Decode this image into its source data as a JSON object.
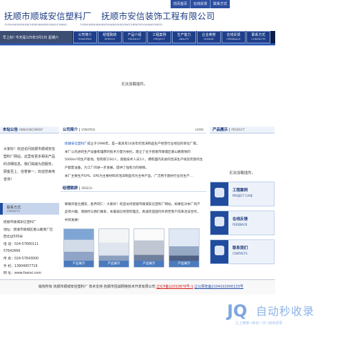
{
  "header": {
    "company_cn_1": "抚顺市顺城安信塑料厂",
    "company_cn_2": "抚顺市安信装饰工程有限公司",
    "pinyin_1": "FUSHUNSHISHUNCHENGANXINSUIJIAOCHANG",
    "pinyin_2": "FUSHUNSHIANXINZHUANGSHIGONGCHENGYOUXIANGONGSI",
    "top_links": [
      "前页首页",
      "在线反馈",
      "联系方式"
    ]
  },
  "nav": {
    "date": "早上好! 今天是125年3月1日 星期六",
    "items": [
      {
        "cn": "公司简介",
        "en": "SYNOPSIS"
      },
      {
        "cn": "经理致辞",
        "en": "SPEECH"
      },
      {
        "cn": "产品介绍",
        "en": "PRODUCT"
      },
      {
        "cn": "工程案例",
        "en": "PROJECT"
      },
      {
        "cn": "生产能力",
        "en": "ABILITY"
      },
      {
        "cn": "企业荣誉",
        "en": "HONOR"
      },
      {
        "cn": "在线反馈",
        "en": "FEEDBACK"
      },
      {
        "cn": "联系方式",
        "en": "CONTACTS"
      }
    ]
  },
  "banner": {
    "text": "无法加载插件。"
  },
  "left": {
    "announcement_title": "本站公告",
    "announcement_en": "ANNOUNCEMENT",
    "announcement_text": "大家好！欢迎访问抚顺市顺城安信塑料厂网站，这里有更多相关产品的详细信息。我们竭诚为您服务，顾客至上、信誉第一，欢迎您来电咨询！",
    "contact_title": "联系方式",
    "contact_en": "CONTACTS",
    "contact_lines": [
      "抚顺市顺城安信塑料厂",
      "地址：抚顺市顺城区葛山路南厂区",
      "西北边500米",
      "电 话：024-57660111 57642666",
      "传 真：024-57643000",
      "手 机：13904957719",
      "网 址：www.fsanxi.com"
    ]
  },
  "center": {
    "intro_title": "公司简介",
    "intro_en": "SYNOPSIS",
    "home_link": "HOME",
    "intro_link": "抚顺安信塑料厂",
    "intro_text_1": "成立于1998年，是一家具有10多年的泡沫制品生产经营行业经验的单位厂家。",
    "intro_text_2": "本厂以先进的生产设备和雄厚的技术力量为依托，建立了位于抚顺市顺城区葛山路南侧的5000m²的生产基地，现有职工60人，高级技术人员5人，拥有国内先进的泡沫生产线及完善的生产配套设备，为工厂的进一步发展，提供了强有力的保障。",
    "intro_text_3": "本厂主要生产EPS、EPE为主要材料的泡沫制品作为主导产品，广泛用于建材行业的生产...",
    "speech_title": "经理致辞",
    "speech_en": "SPEECH",
    "speech_text": "尊敬的各位朋友、各界同仁：大家好！欢迎访问抚顺市顺城安信塑料厂网站，如果您对本厂的产品有兴趣，请随时与我们联系，本着诚信经营的理念，真诚欢迎国内外新老客户前来洽谈合作，共同发展！",
    "photo_labels": [
      "产品展示",
      "产品展示",
      "产品展示",
      "产品展示"
    ]
  },
  "right": {
    "product_title": "产品展示",
    "product_en": "PRODUCT",
    "product_text": "无法加载插件。",
    "buttons": [
      {
        "cn": "工程案例",
        "en": "PROJECT CASE"
      },
      {
        "cn": "在线反馈",
        "en": "FEEDBACK"
      },
      {
        "cn": "联系我们",
        "en": "CONTACTS"
      }
    ]
  },
  "footer": {
    "prefix": "版权所有  抚顺市顺城安信塑料厂   技术支持  抚顺市恒诚网络技术开发有限公司",
    "icp": "辽ICP备12010878号-1",
    "police": "辽公网安备2104102000133号"
  },
  "watermark": {
    "logo": "JQ",
    "brand": "自动秒收录",
    "sub": "让上链接→来访一次→自动收录"
  }
}
